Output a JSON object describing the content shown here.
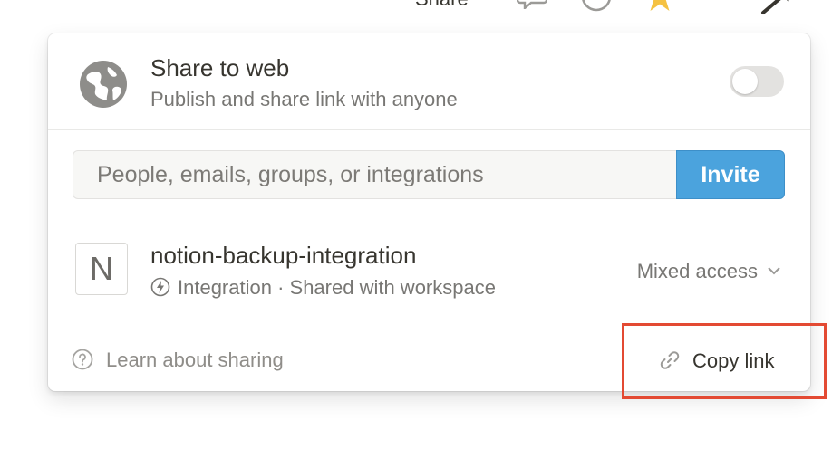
{
  "topbar": {
    "share_label": "Share",
    "icons": [
      "comment-icon",
      "clock-icon",
      "star-icon",
      "more-icon"
    ]
  },
  "share_to_web": {
    "title": "Share to web",
    "subtitle": "Publish and share link with anyone",
    "toggle_on": false
  },
  "invite": {
    "placeholder": "People, emails, groups, or integrations",
    "value": "",
    "button_label": "Invite"
  },
  "member": {
    "avatar_letter": "N",
    "name": "notion-backup-integration",
    "subtitle": "Integration · Shared with workspace",
    "access_label": "Mixed access"
  },
  "footer": {
    "learn_label": "Learn about sharing",
    "copy_label": "Copy link"
  },
  "colors": {
    "accent": "#4ba3dd",
    "highlight": "#e34a33",
    "star": "#f5c242"
  }
}
